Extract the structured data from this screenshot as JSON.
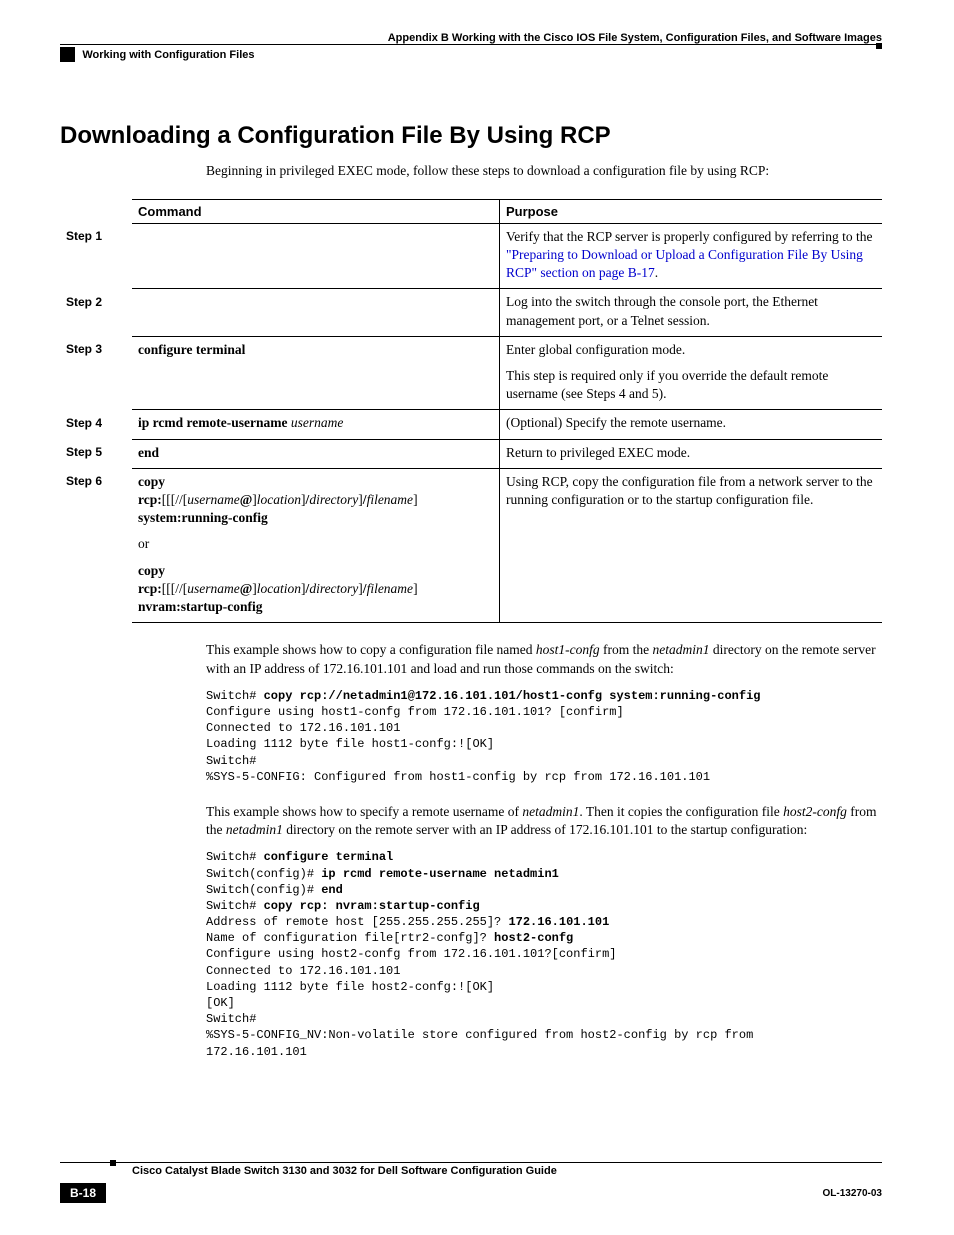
{
  "header": {
    "appendix": "Appendix B      Working with the Cisco IOS File System, Configuration Files, and Software Images",
    "section": "Working with Configuration Files"
  },
  "section_title": "Downloading a Configuration File By Using RCP",
  "intro": "Beginning in privileged EXEC mode, follow these steps to download a configuration file by using RCP:",
  "table": {
    "head_cmd": "Command",
    "head_purpose": "Purpose",
    "rows": [
      {
        "step": "Step 1",
        "cmd_html": "",
        "purpose_pre": "Verify that the RCP server is properly configured by referring to the ",
        "purpose_link": "\"Preparing to Download or Upload a Configuration File By Using RCP\" section on page B-17",
        "purpose_post": "."
      },
      {
        "step": "Step 2",
        "cmd_html": "",
        "purpose": "Log into the switch through the console port, the Ethernet management port, or a Telnet session."
      },
      {
        "step": "Step 3",
        "cmd_bold": "configure terminal",
        "purpose_a": "Enter global configuration mode.",
        "purpose_b": "This step is required only if you override the default remote username (see Steps 4 and 5)."
      },
      {
        "step": "Step 4",
        "cmd_bold": "ip rcmd remote-username",
        "cmd_ital": " username",
        "purpose": "(Optional) Specify the remote username."
      },
      {
        "step": "Step 5",
        "cmd_bold": "end",
        "purpose": "Return to privileged EXEC mode."
      },
      {
        "step": "Step 6",
        "cmd_lines": {
          "copy1": "copy",
          "rcp1_a": "rcp:",
          "rcp1_b": "[[[//[",
          "rcp1_c": "username",
          "rcp1_d": "@",
          "rcp1_e": "]",
          "rcp1_f": "location",
          "rcp1_g": "]",
          "rcp1_h": "/",
          "rcp1_i": "directory",
          "rcp1_j": "]",
          "rcp1_k": "/",
          "rcp1_l": "filename",
          "rcp1_m": "]",
          "sys": "system:running-config",
          "or": "or",
          "copy2": "copy",
          "nv": "nvram:startup-config"
        },
        "purpose": "Using RCP, copy the configuration file from a network server to the running configuration or to the startup configuration file."
      }
    ]
  },
  "para1_a": "This example shows how to copy a configuration file named ",
  "para1_b": "host1-confg",
  "para1_c": " from the ",
  "para1_d": "netadmin1",
  "para1_e": " directory on the remote server with an IP address of 172.16.101.101 and load and run those commands on the switch:",
  "term1": {
    "l1a": "Switch# ",
    "l1b": "copy rcp://netadmin1@172.16.101.101/host1-confg system:running-config",
    "l2": "Configure using host1-confg from 172.16.101.101? [confirm]",
    "l3": "Connected to 172.16.101.101",
    "l4": "Loading 1112 byte file host1-confg:![OK]",
    "l5": "Switch#",
    "l6": "%SYS-5-CONFIG: Configured from host1-config by rcp from 172.16.101.101"
  },
  "para2_a": "This example shows how to specify a remote username of ",
  "para2_b": "netadmin1",
  "para2_c": ". Then it copies the configuration file ",
  "para2_d": "host2-confg",
  "para2_e": " from the ",
  "para2_f": "netadmin1",
  "para2_g": " directory on the remote server with an IP address of 172.16.101.101 to the startup configuration:",
  "term2": {
    "l1a": "Switch# ",
    "l1b": "configure terminal",
    "l2a": "Switch(config)# ",
    "l2b": "ip rcmd remote-username netadmin1",
    "l3a": "Switch(config)# ",
    "l3b": "end",
    "l4a": "Switch# ",
    "l4b": "copy rcp: nvram:startup-config",
    "l5a": "Address of remote host [255.255.255.255]? ",
    "l5b": "172.16.101.101",
    "l6a": "Name of configuration file[rtr2-confg]? ",
    "l6b": "host2-confg",
    "l7": "Configure using host2-confg from 172.16.101.101?[confirm]",
    "l8": "Connected to 172.16.101.101",
    "l9": "Loading 1112 byte file host2-confg:![OK]",
    "l10": "[OK]",
    "l11": "Switch#",
    "l12": "%SYS-5-CONFIG_NV:Non-volatile store configured from host2-config by rcp from",
    "l13": "172.16.101.101"
  },
  "footer": {
    "book": "Cisco Catalyst Blade Switch 3130 and 3032 for Dell Software Configuration Guide",
    "page": "B-18",
    "docid": "OL-13270-03"
  }
}
